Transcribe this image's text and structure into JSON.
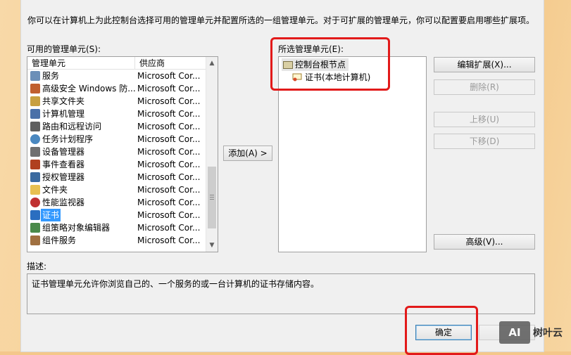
{
  "dialog": {
    "intro_text": "你可以在计算机上为此控制台选择可用的管理单元并配置所选的一组管理单元。对于可扩展的管理单元，你可以配置要启用哪些扩展项。",
    "available_label": "可用的管理单元(S):",
    "selected_label": "所选管理单元(E):",
    "description_label": "描述:",
    "description_text": "证书管理单元允许你浏览自己的、一个服务的或一台计算机的证书存储内容。"
  },
  "available_list": {
    "headers": {
      "name": "管理单元",
      "vendor": "供应商"
    },
    "items": [
      {
        "name": "服务",
        "vendor": "Microsoft Cor...",
        "icon": "services-gear-icon"
      },
      {
        "name": "高级安全 Windows 防...",
        "vendor": "Microsoft Cor...",
        "icon": "firewall-icon"
      },
      {
        "name": "共享文件夹",
        "vendor": "Microsoft Cor...",
        "icon": "shared-folder-icon"
      },
      {
        "name": "计算机管理",
        "vendor": "Microsoft Cor...",
        "icon": "computer-management-icon"
      },
      {
        "name": "路由和远程访问",
        "vendor": "Microsoft Cor...",
        "icon": "routing-icon"
      },
      {
        "name": "任务计划程序",
        "vendor": "Microsoft Cor...",
        "icon": "clock-icon"
      },
      {
        "name": "设备管理器",
        "vendor": "Microsoft Cor...",
        "icon": "device-manager-icon"
      },
      {
        "name": "事件查看器",
        "vendor": "Microsoft Cor...",
        "icon": "event-viewer-icon"
      },
      {
        "name": "授权管理器",
        "vendor": "Microsoft Cor...",
        "icon": "authorization-icon"
      },
      {
        "name": "文件夹",
        "vendor": "Microsoft Cor...",
        "icon": "folder-icon"
      },
      {
        "name": "性能监视器",
        "vendor": "Microsoft Cor...",
        "icon": "performance-icon"
      },
      {
        "name": "证书",
        "vendor": "Microsoft Cor...",
        "icon": "certificate-icon",
        "selected": true
      },
      {
        "name": "组策略对象编辑器",
        "vendor": "Microsoft Cor...",
        "icon": "group-policy-icon"
      },
      {
        "name": "组件服务",
        "vendor": "Microsoft Cor...",
        "icon": "component-services-icon"
      }
    ]
  },
  "selected_tree": {
    "root": "控制台根节点",
    "child": "证书(本地计算机)"
  },
  "buttons": {
    "add": "添加(A) >",
    "edit_extensions": "编辑扩展(X)...",
    "remove": "删除(R)",
    "move_up": "上移(U)",
    "move_down": "下移(D)",
    "advanced": "高级(V)...",
    "ok": "确定"
  },
  "watermark": {
    "text": "树叶云",
    "logo": "AI"
  },
  "colors": {
    "highlight_red": "#e21a1a",
    "selection_blue": "#3399ff",
    "background_orange": "#f4c78a"
  }
}
